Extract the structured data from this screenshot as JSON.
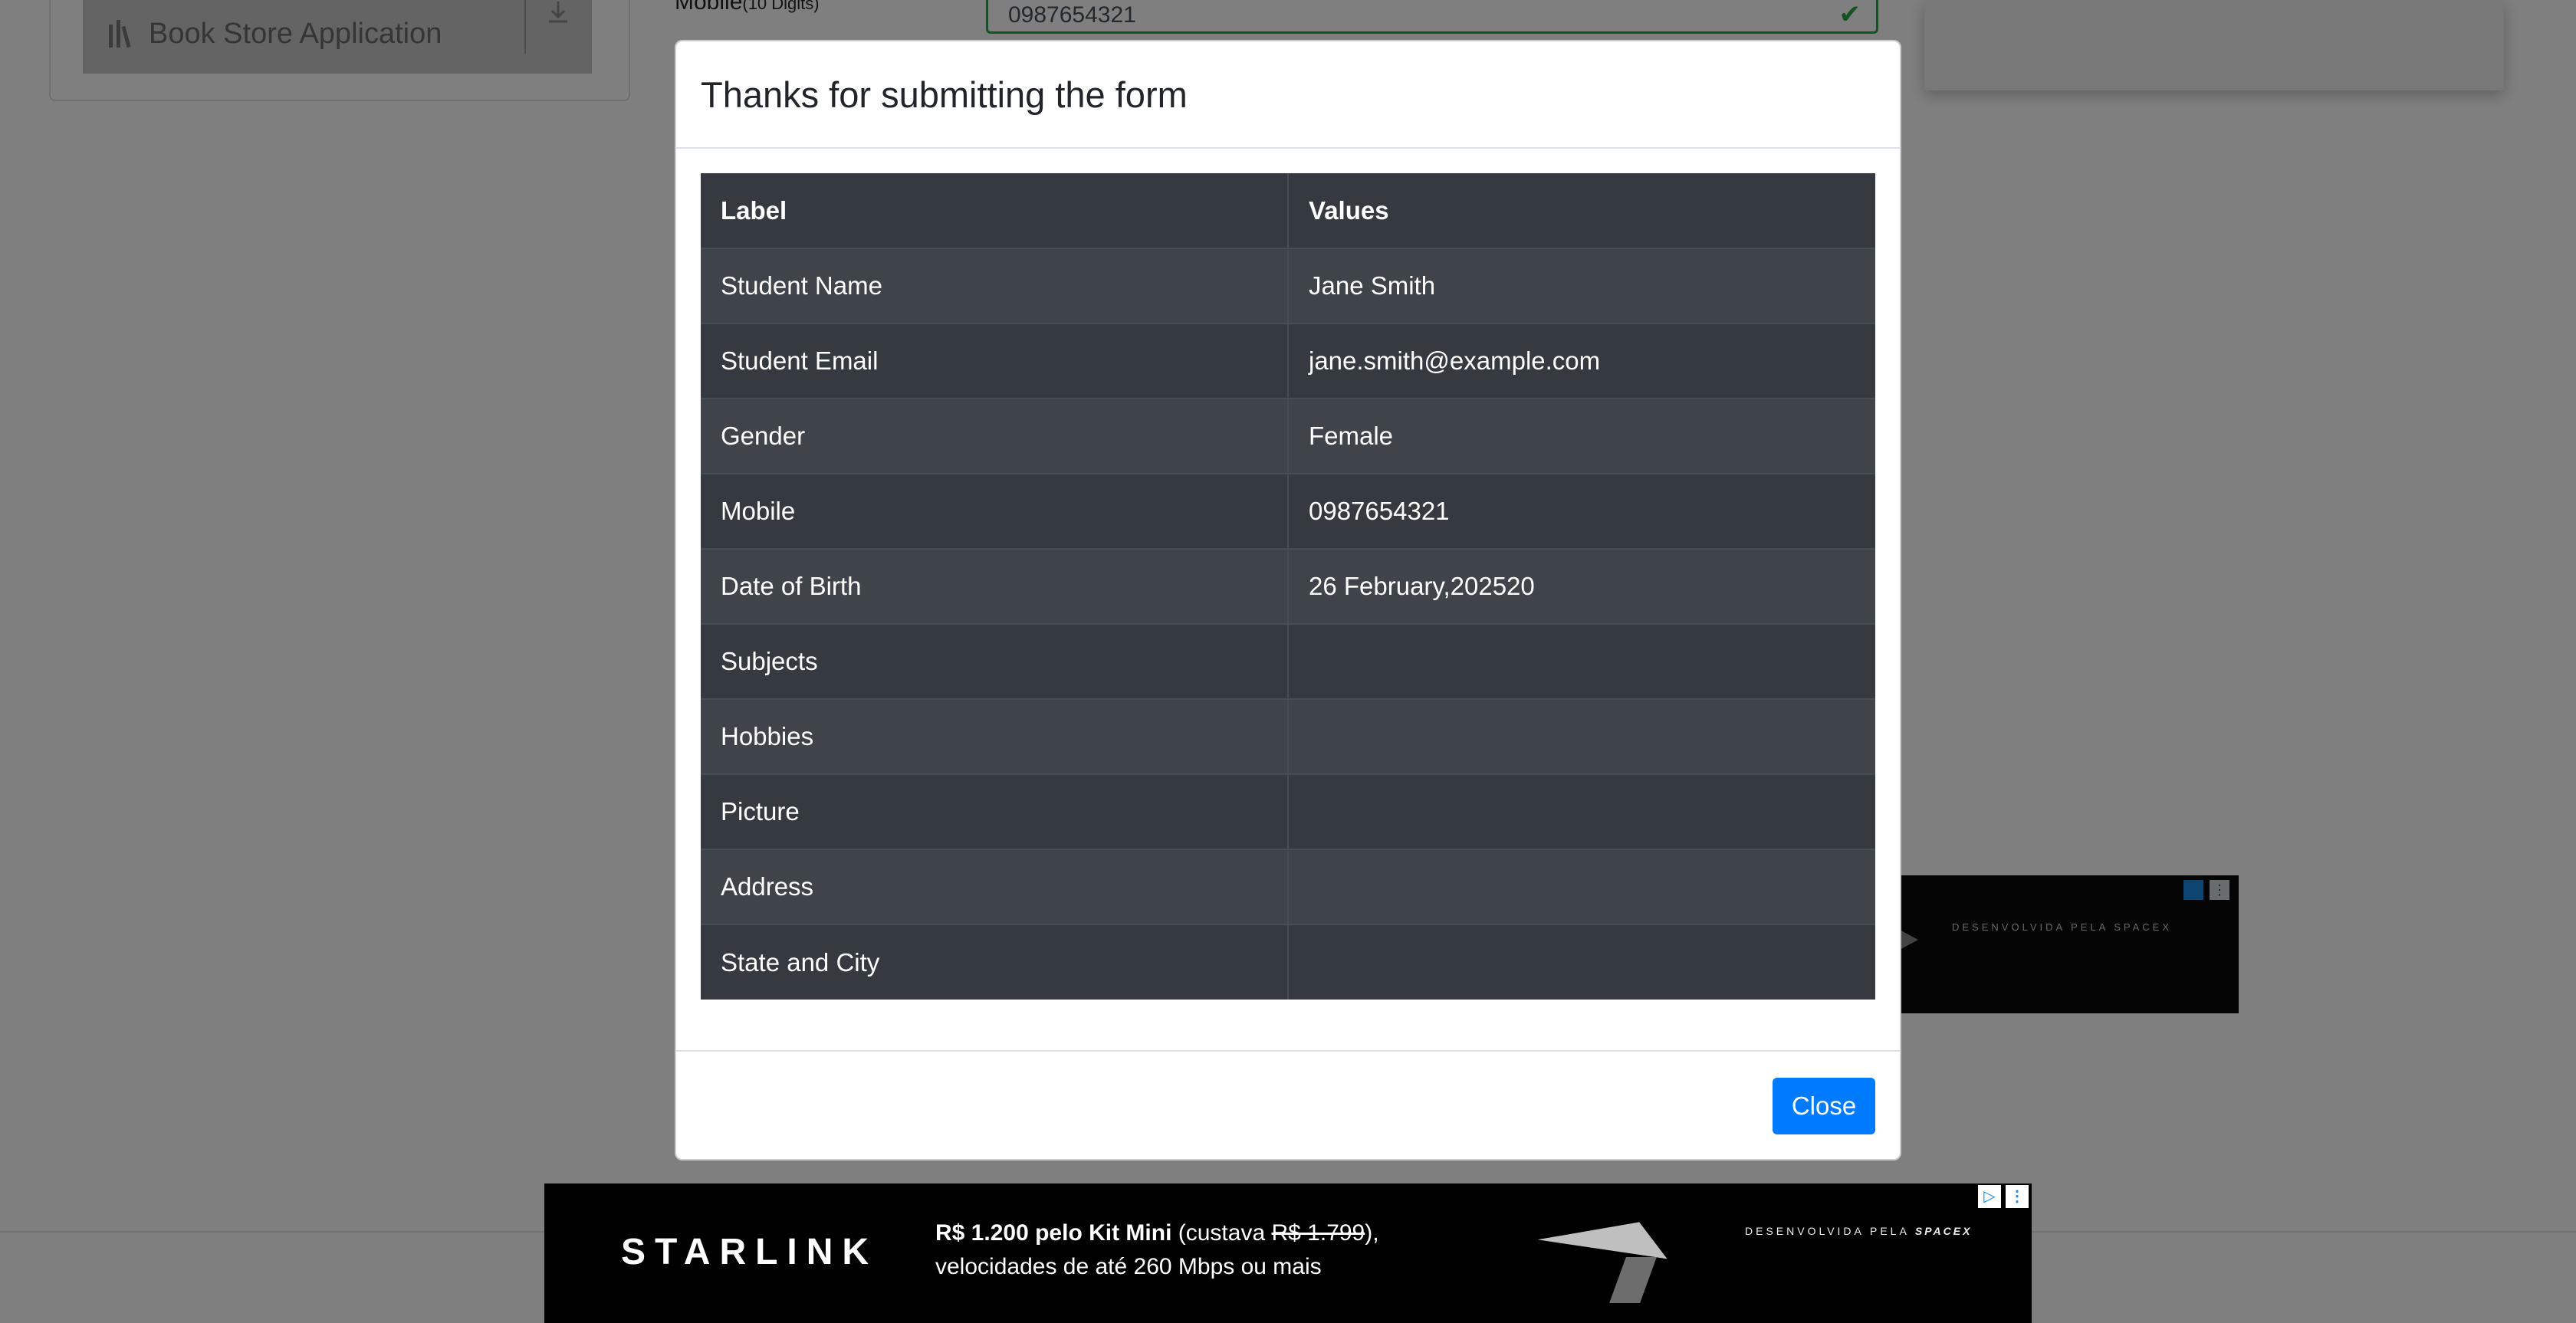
{
  "background": {
    "sidebar": {
      "item_label": "Book Store Application"
    },
    "form": {
      "mobile_label": "Mobile",
      "mobile_hint": "(10 Digits)",
      "mobile_value": "0987654321"
    },
    "side_ad": {
      "brand": "DESENVOLVIDA PELA SPACEX"
    }
  },
  "modal": {
    "title": "Thanks for submitting the form",
    "table": {
      "headers": [
        "Label",
        "Values"
      ],
      "rows": [
        {
          "label": "Student Name",
          "value": "Jane Smith"
        },
        {
          "label": "Student Email",
          "value": "jane.smith@example.com"
        },
        {
          "label": "Gender",
          "value": "Female"
        },
        {
          "label": "Mobile",
          "value": "0987654321"
        },
        {
          "label": "Date of Birth",
          "value": "26 February,202520"
        },
        {
          "label": "Subjects",
          "value": ""
        },
        {
          "label": "Hobbies",
          "value": ""
        },
        {
          "label": "Picture",
          "value": ""
        },
        {
          "label": "Address",
          "value": ""
        },
        {
          "label": "State and City",
          "value": ""
        }
      ]
    },
    "close_label": "Close"
  },
  "banner_ad": {
    "logo": "STARLINK",
    "offer_bold": "R$ 1.200 pelo Kit Mini",
    "offer_prefix": " (custava ",
    "offer_strike": "R$ 1.799",
    "offer_suffix": "),",
    "line2": "velocidades de até 260 Mbps ou mais",
    "brand_prefix": "DESENVOLVIDA PELA ",
    "brand_name": "SPACEX"
  },
  "colors": {
    "primary": "#007bff",
    "success": "#28a745",
    "table_dark": "#343a40"
  }
}
